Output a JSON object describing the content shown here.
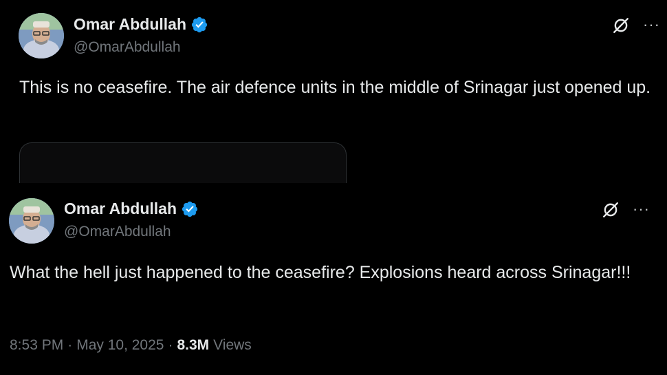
{
  "tweets": [
    {
      "author_name": "Omar Abdullah",
      "handle": "@OmarAbdullah",
      "text": "This is no ceasefire. The air defence units in the middle of Srinagar just opened up."
    },
    {
      "author_name": "Omar Abdullah",
      "handle": "@OmarAbdullah",
      "text": "What the hell just happened to the ceasefire? Explosions heard across Srinagar!!!",
      "time": "8:53 PM",
      "date": "May 10, 2025",
      "separator": "·",
      "views_count": "8.3M",
      "views_label": "Views"
    }
  ],
  "icons": {
    "more": "more-icon",
    "grok": "grok-icon",
    "verified": "verified-badge-icon"
  },
  "colors": {
    "background": "#000000",
    "text": "#e7e9ea",
    "secondary": "#71767b",
    "verified": "#1d9bf0"
  },
  "more_glyph": "···"
}
